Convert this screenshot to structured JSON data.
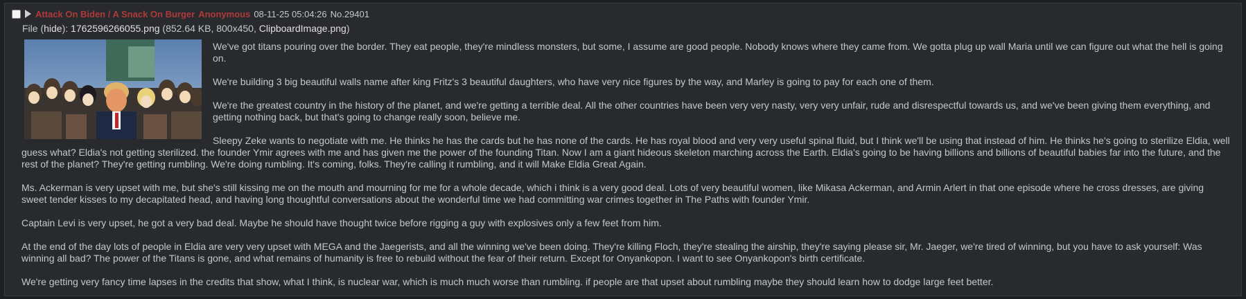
{
  "post": {
    "subject": "Attack On Biden / A Snack On Burger",
    "name": "Anonymous",
    "datetime": "08-11-25 05:04:26",
    "number": "No.29401",
    "file": {
      "prefix": "File (",
      "hide_label": "hide",
      "sep": "):",
      "filename": "1762596266055.png",
      "details": "(852.64 KB, 800x450,",
      "original_name": "ClipboardImage.png",
      "close": ")"
    },
    "paragraphs": [
      "We've got titans pouring over the border. They eat people, they're mindless monsters, but some, I assume are good people. Nobody knows where they came from. We gotta plug up wall Maria until we can figure out what the hell is going on.",
      "We're building 3 big beautiful walls name after king Fritz's 3 beautiful daughters, who have very nice figures by the way, and Marley is going to pay for each one of them.",
      "We're the greatest country in the history of the planet, and we're getting a terrible deal. All the other countries have been very very nasty, very very unfair, rude and disrespectful towards us, and we've been giving them everything, and getting nothing back, but that's going to change really soon, believe me.",
      "Sleepy Zeke wants to negotiate with me. He thinks he has the cards but he has none of the cards. He has royal blood and very very useful spinal fluid, but I think we'll be using that instead of him. He thinks he's going to sterilize Eldia, well guess what? Eldia's not getting sterilized. the founder Ymir agrees with me and has given me the power of the founding Titan. Now I am a giant hideous skeleton marching across the Earth. Eldia's going to be having billions and billions of beautiful babies far into the future, and the rest of the planet? They're getting rumbling. We're doing rumbling. It's coming, folks. They're calling it rumbling, and it will Make Eldia Great Again.",
      "Ms. Ackerman is very upset with me, but she's still kissing me on the mouth and mourning for me for a whole decade, which i think is a very good deal. Lots of very beautiful women, like Mikasa Ackerman, and Armin Arlert in that one episode where he cross dresses, are giving sweet tender kisses to my decapitated head, and having long thoughtful conversations about the wonderful time we had committing war crimes together in The Paths with founder Ymir.",
      "Captain Levi is very upset, he got a very bad deal. Maybe he should have thought twice before rigging a guy with explosives only a few feet from him.",
      "At the end of the day lots of people in Eldia are very very upset with MEGA and the Jaegerists, and all the winning we've been doing. They're killing Floch, they're stealing the airship, they're saying please sir, Mr. Jaeger, we're tired of winning, but you have to ask yourself: Was winning all bad? The power of the Titans is gone, and what remains of humanity is free to rebuild without the fear of their return. Except for Onyankopon. I want to see Onyankopon's birth certificate.",
      "We're getting very fancy time lapses in the credits that show, what I think, is nuclear war, which is much much worse than rumbling. if people are that upset about rumbling maybe they should learn how to dodge large feet better."
    ]
  },
  "colors": {
    "background": "#1d1f21",
    "post_background": "#282a2e",
    "text": "#c5c8c6",
    "subject": "#b03a3a",
    "name": "#b03a3a"
  },
  "icons": {
    "checkbox": "checkbox-icon",
    "expand": "expand-triangle-icon"
  }
}
